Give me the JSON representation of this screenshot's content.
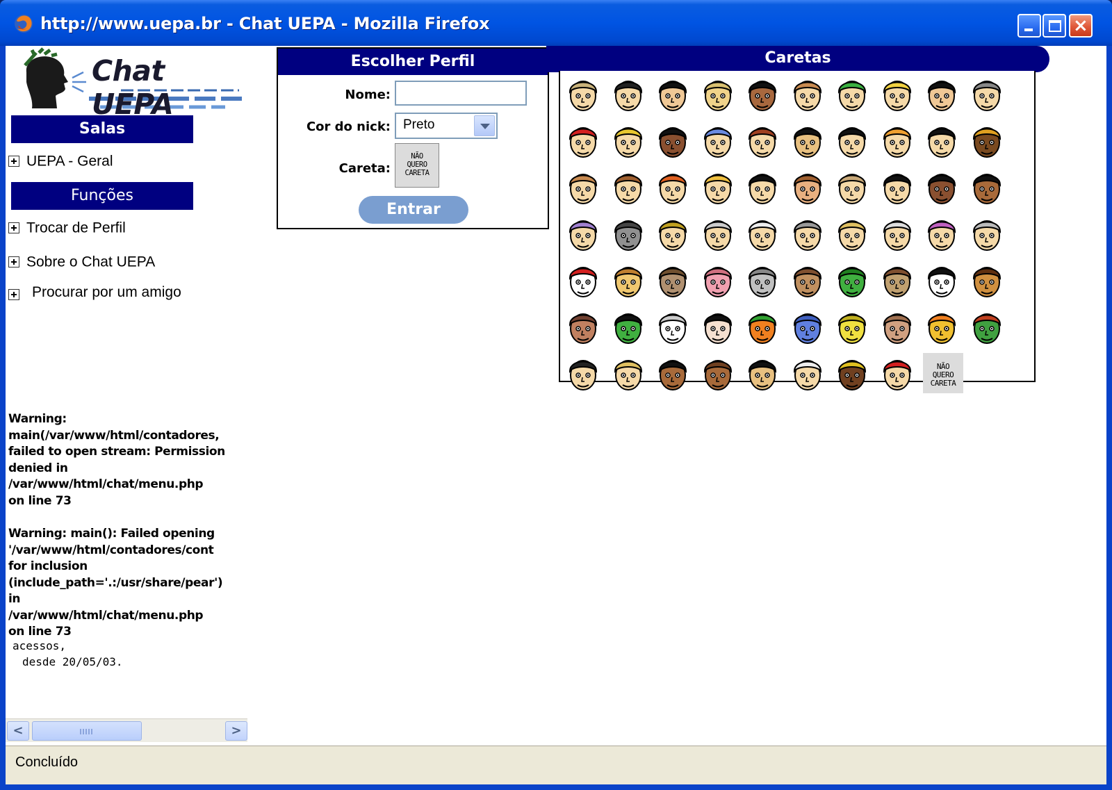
{
  "window": {
    "title": "http://www.uepa.br - Chat UEPA - Mozilla Firefox",
    "buttons": {
      "minimize": "minimize",
      "maximize": "maximize",
      "close": "×"
    }
  },
  "sidebar": {
    "logo_text": "Chat UEPA",
    "salas_header": "Salas",
    "salas_items": [
      {
        "label": "UEPA - Geral"
      }
    ],
    "funcoes_header": "Funções",
    "funcoes_items": [
      {
        "label": "Trocar de Perfil"
      },
      {
        "label": "Sobre o Chat UEPA"
      },
      {
        "label": "Procurar por um amigo"
      }
    ],
    "warnings": [
      "Warning:\nmain(/var/www/html/contadores,\nfailed to open stream: Permission\ndenied in\n/var/www/html/chat/menu.php\non line 73",
      "Warning: main(): Failed opening\n'/var/www/html/contadores/cont\nfor inclusion\n(include_path='.:/usr/share/pear')\nin\n/var/www/html/chat/menu.php\non line 73"
    ],
    "counter_line1": "acessos,",
    "counter_line2": "desde 20/05/03."
  },
  "profile": {
    "header": "Escolher Perfil",
    "nome_label": "Nome:",
    "nome_value": "",
    "cor_label": "Cor do nick:",
    "cor_value": "Preto",
    "careta_label": "Careta:",
    "careta_line1": "NÃO",
    "careta_line2": "QUERO",
    "careta_line3": "CARETA",
    "entrar_label": "Entrar"
  },
  "caretas": {
    "header": "Caretas",
    "nq_line1": "NÃO",
    "nq_line2": "QUERO",
    "nq_line3": "CARETA",
    "rows": [
      [
        {
          "skin": "#f5d9a8",
          "hair": "#c9b27a",
          "name": "cowboy-face-icon"
        },
        {
          "skin": "#f5d9a8",
          "hair": "#222",
          "name": "cap-face-icon"
        },
        {
          "skin": "#f0c896",
          "hair": "#111",
          "name": "dark-hair-face-icon"
        },
        {
          "skin": "#f0d38a",
          "hair": "#d9c070",
          "name": "glasses-face-icon"
        },
        {
          "skin": "#a8683e",
          "hair": "#111",
          "name": "afro-face-icon"
        },
        {
          "skin": "#f5d9a8",
          "hair": "#c88a50",
          "name": "bald-face-icon"
        },
        {
          "skin": "#f5d9a8",
          "hair": "#3bb040",
          "name": "green-mohawk-face-icon"
        },
        {
          "skin": "#f5d9a8",
          "hair": "#f0d040",
          "name": "blond-face-icon"
        },
        {
          "skin": "#f0c896",
          "hair": "#111",
          "name": "black-hair-face-icon"
        },
        {
          "skin": "#f5d9a8",
          "hair": "#888",
          "name": "gray-hair-face-icon"
        }
      ],
      [
        {
          "skin": "#f5d9a8",
          "hair": "#d42020",
          "name": "redhead-face-icon"
        },
        {
          "skin": "#f5d9a8",
          "hair": "#e8c830",
          "name": "green-glasses-face-icon"
        },
        {
          "skin": "#8a5030",
          "hair": "#111",
          "name": "dark-woman-face-icon"
        },
        {
          "skin": "#f5d9a8",
          "hair": "#6a8ae0",
          "name": "blue-hair-face-icon"
        },
        {
          "skin": "#f5d9a8",
          "hair": "#a04020",
          "name": "beret-face-icon"
        },
        {
          "skin": "#e8c080",
          "hair": "#111",
          "name": "asian-face-icon"
        },
        {
          "skin": "#f5d9a8",
          "hair": "#111",
          "name": "curly-glasses-face-icon"
        },
        {
          "skin": "#f5d9a8",
          "hair": "#f0a030",
          "name": "orange-hair-face-icon"
        },
        {
          "skin": "#f5d9a8",
          "hair": "#111",
          "name": "bob-face-icon"
        },
        {
          "skin": "#7a4a20",
          "hair": "#e0a020",
          "name": "headband-face-icon"
        }
      ],
      [
        {
          "skin": "#f5d9a8",
          "hair": "#c88a50",
          "name": "plain-face-icon"
        },
        {
          "skin": "#f5d9a8",
          "hair": "#a06030",
          "name": "brown-hair-face-icon"
        },
        {
          "skin": "#f5d9a8",
          "hair": "#e06020",
          "name": "ginger-face-icon"
        },
        {
          "skin": "#f5d9a8",
          "hair": "#f0c040",
          "name": "blonde-woman-face-icon"
        },
        {
          "skin": "#f5d9a8",
          "hair": "#111",
          "name": "black-bowl-face-icon"
        },
        {
          "skin": "#e8b080",
          "hair": "#a06030",
          "name": "smiling-face-icon"
        },
        {
          "skin": "#f5d9a8",
          "hair": "#c8a878",
          "name": "hat-face-icon"
        },
        {
          "skin": "#f5d9a8",
          "hair": "#111",
          "name": "pigtails-face-icon"
        },
        {
          "skin": "#8a5030",
          "hair": "#111",
          "name": "dark-man-face-icon"
        },
        {
          "skin": "#a86a3a",
          "hair": "#111",
          "name": "earrings-face-icon"
        }
      ],
      [
        {
          "skin": "#f5d9a8",
          "hair": "#a080d0",
          "name": "purple-hair-face-icon"
        },
        {
          "skin": "#909090",
          "hair": "#444",
          "name": "gray-man-face-icon"
        },
        {
          "skin": "#f5d9a8",
          "hair": "#c0a020",
          "name": "yellow-glasses-face-icon"
        },
        {
          "skin": "#f5d9a8",
          "hair": "#ccc",
          "name": "old-man-face-icon"
        },
        {
          "skin": "#f5d9a8",
          "hair": "#eee",
          "name": "grandma-face-icon"
        },
        {
          "skin": "#f5d9a8",
          "hair": "#999",
          "name": "balding-face-icon"
        },
        {
          "skin": "#f5d9a8",
          "hair": "#e0c060",
          "name": "curly-blond-face-icon"
        },
        {
          "skin": "#f5d9a8",
          "hair": "#ddd",
          "name": "white-hair-face-icon"
        },
        {
          "skin": "#f5d9a8",
          "hair": "#c060c0",
          "name": "curlers-face-icon"
        },
        {
          "skin": "#f5d9a8",
          "hair": "#bbb",
          "name": "gray-old-face-icon"
        }
      ],
      [
        {
          "skin": "#fff",
          "hair": "#d42020",
          "name": "chicken-icon"
        },
        {
          "skin": "#f0c870",
          "hair": "#c08030",
          "name": "dog-icon"
        },
        {
          "skin": "#b09070",
          "hair": "#705030",
          "name": "cat-icon"
        },
        {
          "skin": "#f0a0b0",
          "hair": "#d07080",
          "name": "pig-icon"
        },
        {
          "skin": "#c0c0c0",
          "hair": "#888",
          "name": "mouse-icon"
        },
        {
          "skin": "#c09060",
          "hair": "#805030",
          "name": "cow-icon"
        },
        {
          "skin": "#40b040",
          "hair": "#208020",
          "name": "frog-icon"
        },
        {
          "skin": "#c0a070",
          "hair": "#805030",
          "name": "reindeer-icon"
        },
        {
          "skin": "#fff",
          "hair": "#111",
          "name": "panda-icon"
        },
        {
          "skin": "#d09040",
          "hair": "#603010",
          "name": "tiger-icon"
        }
      ],
      [
        {
          "skin": "#c08060",
          "hair": "#704030",
          "name": "devil-face-icon"
        },
        {
          "skin": "#40b040",
          "hair": "#111",
          "name": "frankenstein-icon"
        },
        {
          "skin": "#fff",
          "hair": "#ccc",
          "name": "skull-icon"
        },
        {
          "skin": "#f5e0d0",
          "hair": "#111",
          "name": "vampire-icon"
        },
        {
          "skin": "#f08020",
          "hair": "#30a030",
          "name": "carrot-icon"
        },
        {
          "skin": "#6080e0",
          "hair": "#4060c0",
          "name": "blue-monster-icon"
        },
        {
          "skin": "#f0e040",
          "hair": "#c0b020",
          "name": "banana-icon"
        },
        {
          "skin": "#d0a080",
          "hair": "#a07050",
          "name": "zombie-icon"
        },
        {
          "skin": "#f0c030",
          "hair": "#f08020",
          "name": "sun-icon"
        },
        {
          "skin": "#40a040",
          "hair": "#c04020",
          "name": "goblin-icon"
        }
      ],
      [
        {
          "skin": "#f5d9a8",
          "hair": "#222",
          "name": "gaucho-icon"
        },
        {
          "skin": "#f5d9a8",
          "hair": "#e0c060",
          "name": "blond-boy-icon"
        },
        {
          "skin": "#a86a3a",
          "hair": "#111",
          "name": "indigenous-icon"
        },
        {
          "skin": "#a86a3a",
          "hair": "#704020",
          "name": "cangaceiro-icon"
        },
        {
          "skin": "#e8c080",
          "hair": "#111",
          "name": "smiling-man-icon"
        },
        {
          "skin": "#f5d9a8",
          "hair": "#eee",
          "name": "old-bearded-icon"
        },
        {
          "skin": "#704020",
          "hair": "#e0c020",
          "name": "rasta-icon"
        },
        {
          "skin": "#f5d9a8",
          "hair": "#d42020",
          "name": "santa-icon"
        },
        {
          "nq": true,
          "name": "nao-quero-careta-icon"
        }
      ]
    ]
  },
  "statusbar": {
    "text": "Concluído"
  }
}
